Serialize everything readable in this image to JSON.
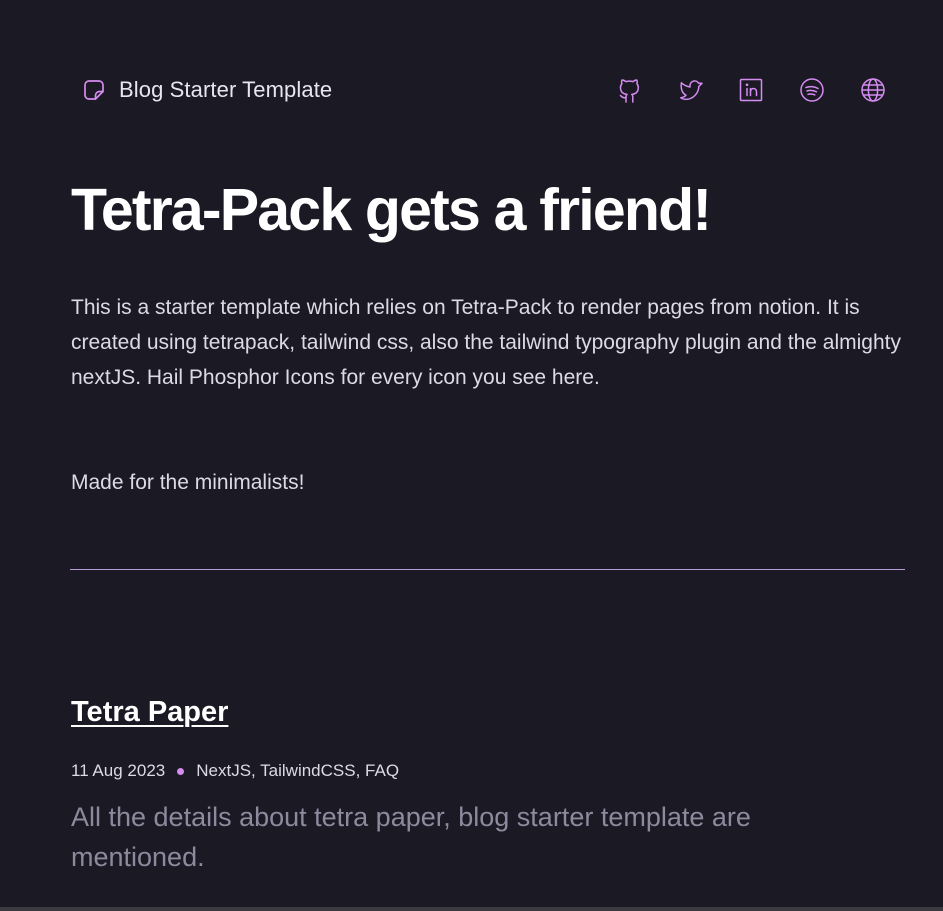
{
  "colors": {
    "background": "#1b1924",
    "accent": "#d58cf1",
    "divider": "#b79bd6",
    "muted_text": "#8d8a9d"
  },
  "header": {
    "brand_icon": "sticker-icon",
    "brand_label": "Blog Starter Template",
    "social_icons": [
      "github-icon",
      "twitter-icon",
      "linkedin-icon",
      "spotify-icon",
      "globe-icon"
    ]
  },
  "hero": {
    "title": "Tetra-Pack gets a friend!",
    "intro": "This is a starter template which relies on Tetra-Pack to render pages from notion. It is created using tetrapack, tailwind css, also the tailwind typography plugin and the almighty nextJS. Hail Phosphor Icons for every icon you see here.",
    "tagline": "Made for the minimalists!"
  },
  "posts": [
    {
      "title": "Tetra Paper",
      "date": "11 Aug 2023",
      "tags": "NextJS, TailwindCSS, FAQ",
      "excerpt": "All the details about tetra paper, blog starter template are mentioned."
    }
  ]
}
